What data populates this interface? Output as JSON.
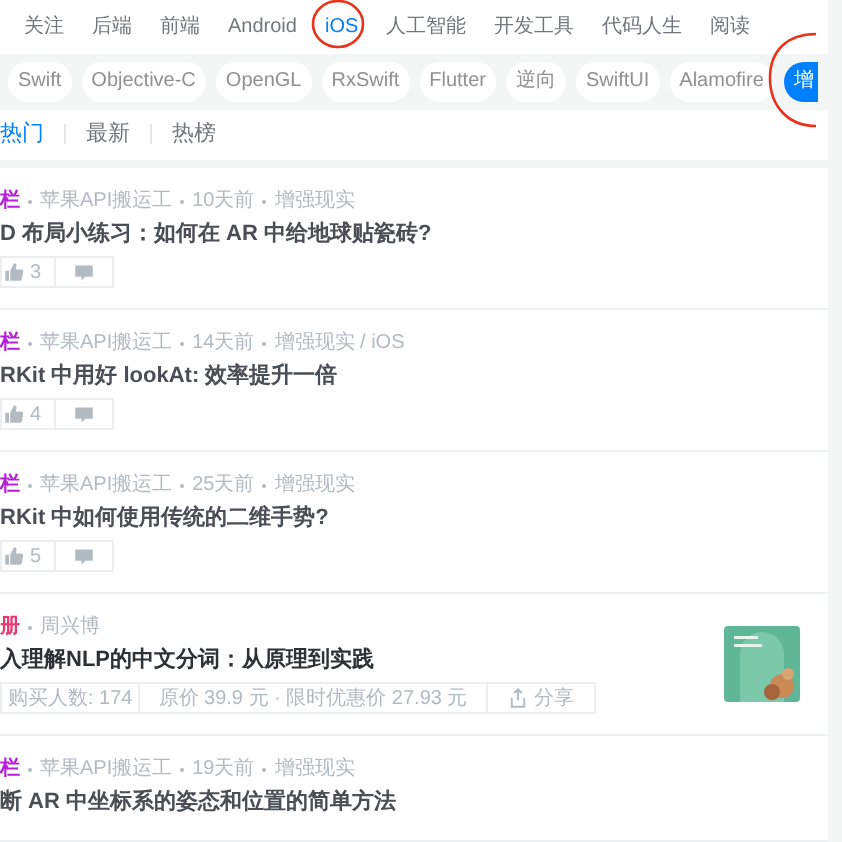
{
  "nav": [
    {
      "label": "关注",
      "selected": false
    },
    {
      "label": "后端",
      "selected": false
    },
    {
      "label": "前端",
      "selected": false
    },
    {
      "label": "Android",
      "selected": false
    },
    {
      "label": "iOS",
      "selected": true,
      "circled": true
    },
    {
      "label": "人工智能",
      "selected": false
    },
    {
      "label": "开发工具",
      "selected": false
    },
    {
      "label": "代码人生",
      "selected": false
    },
    {
      "label": "阅读",
      "selected": false
    }
  ],
  "tags": [
    {
      "label": "Swift",
      "selected": false
    },
    {
      "label": "Objective-C",
      "selected": false
    },
    {
      "label": "OpenGL",
      "selected": false
    },
    {
      "label": "RxSwift",
      "selected": false
    },
    {
      "label": "Flutter",
      "selected": false
    },
    {
      "label": "逆向",
      "selected": false
    },
    {
      "label": "SwiftUI",
      "selected": false
    },
    {
      "label": "Alamofire",
      "selected": false
    },
    {
      "label": "增",
      "selected": true,
      "circled": true
    }
  ],
  "sort_tabs": [
    {
      "label": "热门",
      "selected": true
    },
    {
      "label": "最新",
      "selected": false
    },
    {
      "label": "热榜",
      "selected": false
    }
  ],
  "articles": [
    {
      "kind": "post",
      "category": "栏",
      "color": "#b71ed7",
      "author": "苹果API搬运工",
      "time": "10天前",
      "tags": "增强现实",
      "title": "D 布局小练习：如何在 AR 中给地球贴瓷砖?",
      "likes": "3"
    },
    {
      "kind": "post",
      "category": "栏",
      "color": "#b71ed7",
      "author": "苹果API搬运工",
      "time": "14天前",
      "tags": "增强现实 / iOS",
      "title": "RKit 中用好 lookAt: 效率提升一倍",
      "likes": "4"
    },
    {
      "kind": "post",
      "category": "栏",
      "color": "#b71ed7",
      "author": "苹果API搬运工",
      "time": "25天前",
      "tags": "增强现实",
      "title": "RKit 中如何使用传统的二维手势?",
      "likes": "5"
    },
    {
      "kind": "book",
      "category": "册",
      "color": "#e8396f",
      "author": "周兴博",
      "title": "入理解NLP的中文分词：从原理到实践",
      "buyers": "购买人数: 174",
      "price": "原价 39.9 元 · 限时优惠价 27.93 元",
      "share": "分享"
    },
    {
      "kind": "post",
      "category": "栏",
      "color": "#b71ed7",
      "author": "苹果API搬运工",
      "time": "19天前",
      "tags": "增强现实",
      "title": "断 AR 中坐标系的姿态和位置的简单方法"
    }
  ]
}
